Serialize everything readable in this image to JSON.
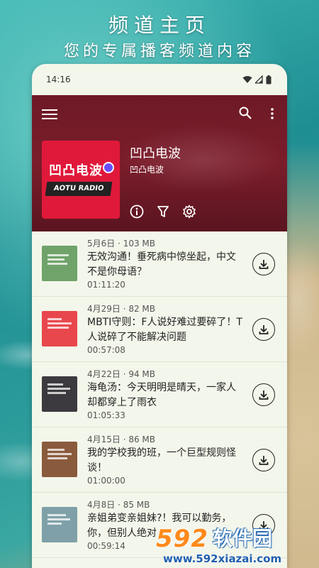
{
  "promo": {
    "title": "频道主页",
    "subtitle": "您的专属播客频道内容"
  },
  "status_bar": {
    "time": "14:16",
    "icons": [
      "wifi-icon",
      "signal-icon",
      "battery-icon"
    ]
  },
  "channel": {
    "title": "凹凸电波",
    "author": "凹凸电波",
    "cover_logo_text": "凹凸电波",
    "cover_band_text": "AOTU RADIO",
    "header_color": "#6e1a26",
    "cover_color": "#e0193a"
  },
  "header_actions": [
    "info-icon",
    "filter-icon",
    "settings-icon"
  ],
  "episodes": [
    {
      "date_size": "5月6日 · 103 MB",
      "title": "无效沟通！垂死病中惊坐起，中文不是你母语？",
      "duration": "01:11:20",
      "thumb_color": "#6fa36a"
    },
    {
      "date_size": "4月29日 · 82 MB",
      "title": "MBTI守则：F人说好难过要碎了！T人说碎了不能解决问题",
      "duration": "00:57:08",
      "thumb_color": "#e8474d"
    },
    {
      "date_size": "4月22日 · 94 MB",
      "title": "海龟汤：今天明明是晴天，一家人却都穿上了雨衣",
      "duration": "01:05:33",
      "thumb_color": "#3c3a3f"
    },
    {
      "date_size": "4月15日 · 86 MB",
      "title": "我的学校我的班，一个巨型规则怪谈！",
      "duration": "01:00:00",
      "thumb_color": "#8a5a3c"
    },
    {
      "date_size": "4月8日 · 85 MB",
      "title": "亲姐弟变亲姐妹?！我可以勤务，你，但别人绝对",
      "duration": "00:59:14",
      "thumb_color": "#7fa0a8"
    }
  ],
  "watermark": {
    "number": "592",
    "brand": "软件园",
    "url": "www.592xiazai.com"
  },
  "colors": {
    "accent_dark": "#222222",
    "list_background": "#f3f6ea",
    "watermark_orange": "#ff8a1c",
    "watermark_blue": "#1f5fae"
  }
}
